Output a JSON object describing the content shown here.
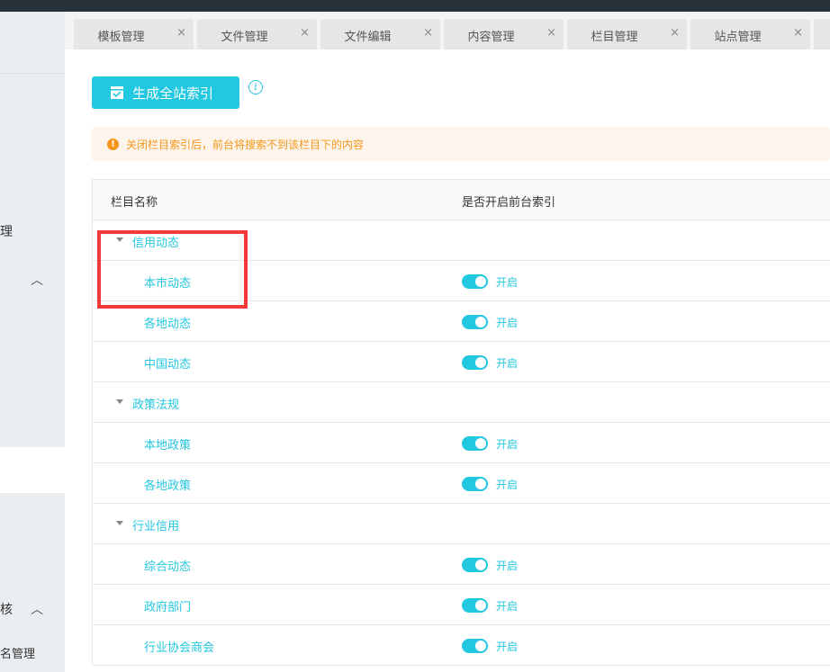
{
  "sidebar": {
    "items": [
      {
        "label": "理"
      },
      {
        "label": "核"
      },
      {
        "label": "名管理"
      }
    ]
  },
  "tabs": [
    {
      "label": "模板管理"
    },
    {
      "label": "文件管理"
    },
    {
      "label": "文件编辑"
    },
    {
      "label": "内容管理"
    },
    {
      "label": "栏目管理"
    },
    {
      "label": "站点管理"
    }
  ],
  "close_glyph": "×",
  "toolbar": {
    "generate_label": "生成全站索引",
    "info_glyph": "i"
  },
  "alert": {
    "icon": "!",
    "text": "关闭栏目索引后，前台将搜索不到该栏目下的内容"
  },
  "table": {
    "headers": [
      "栏目名称",
      "是否开启前台索引"
    ],
    "rows": [
      {
        "name": "信用动态",
        "type": "parent"
      },
      {
        "name": "本市动态",
        "type": "child",
        "status": "开启",
        "enabled": true
      },
      {
        "name": "各地动态",
        "type": "child",
        "status": "开启",
        "enabled": true
      },
      {
        "name": "中国动态",
        "type": "child",
        "status": "开启",
        "enabled": true
      },
      {
        "name": "政策法规",
        "type": "parent"
      },
      {
        "name": "本地政策",
        "type": "child",
        "status": "开启",
        "enabled": true
      },
      {
        "name": "各地政策",
        "type": "child",
        "status": "开启",
        "enabled": true
      },
      {
        "name": "行业信用",
        "type": "parent"
      },
      {
        "name": "综合动态",
        "type": "child",
        "status": "开启",
        "enabled": true
      },
      {
        "name": "政府部门",
        "type": "child",
        "status": "开启",
        "enabled": true
      },
      {
        "name": "行业协会商会",
        "type": "child",
        "status": "开启",
        "enabled": true
      }
    ]
  },
  "colors": {
    "accent": "#22c7e0",
    "warning": "#f5961b",
    "highlight": "#f23a3a"
  }
}
